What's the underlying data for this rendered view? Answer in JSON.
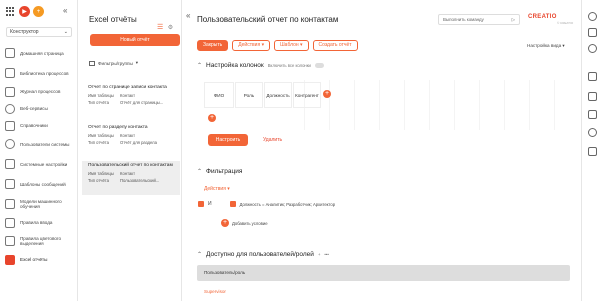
{
  "sidebar": {
    "workspace": "Конструктор",
    "items": [
      {
        "label": "Домашняя страница",
        "icon": "home-icon"
      },
      {
        "label": "Библиотека процессов",
        "icon": "process-library-icon"
      },
      {
        "label": "Журнал процессов",
        "icon": "process-log-icon"
      },
      {
        "label": "Веб-сервисы",
        "icon": "globe-icon"
      },
      {
        "label": "Справочники",
        "icon": "lookups-icon"
      },
      {
        "label": "Пользователи системы",
        "icon": "users-icon"
      },
      {
        "label": "Системные настройки",
        "icon": "system-settings-icon"
      },
      {
        "label": "Шаблоны сообщений",
        "icon": "message-templates-icon"
      },
      {
        "label": "Модели машинного обучения",
        "icon": "ml-models-icon"
      },
      {
        "label": "Правила ввода",
        "icon": "input-rules-icon"
      },
      {
        "label": "Правила цветового выделения",
        "icon": "color-rules-icon"
      },
      {
        "label": "Excel отчёты",
        "icon": "excel-reports-icon"
      }
    ]
  },
  "reports": {
    "title": "Excel отчёты",
    "new_button": "Новый отчёт",
    "filters": "Фильтры/группы",
    "cards": [
      {
        "title": "Отчет по странице записи контакта",
        "table_key": "Имя таблицы",
        "table_val": "Контакт",
        "type_key": "Тип отчёта",
        "type_val": "Отчёт для страницы..."
      },
      {
        "title": "Отчет по разделу контакта",
        "table_key": "Имя таблицы",
        "table_val": "Контакт",
        "type_key": "Тип отчёта",
        "type_val": "Отчёт для раздела"
      },
      {
        "title": "Пользовательский отчет по контактам",
        "table_key": "Имя таблицы",
        "table_val": "Контакт",
        "type_key": "Тип отчёта",
        "type_val": "Пользовательский..."
      }
    ]
  },
  "header": {
    "title": "Пользовательский отчет по контактам",
    "command_placeholder": "Выполнить команду",
    "brand": "CREATIO",
    "brand_sub": "© CREATIO"
  },
  "toolbar": {
    "close": "Закрыть",
    "actions": "Действия",
    "template": "Шаблон",
    "create_report": "Создать отчёт",
    "view_settings": "Настройка вида"
  },
  "columns_section": {
    "title": "Настройка колонок",
    "include_all": "Включить все колонки",
    "columns": [
      "ФИО",
      "Роль",
      "Должность",
      "Контрагент"
    ],
    "configure": "Настроить",
    "delete": "Удалить"
  },
  "filter_section": {
    "title": "Фильтрация",
    "actions": "Действия",
    "logic": "И",
    "condition": "Должность = Аналитик; Разработчик; Архитектор",
    "add_condition": "Добавить условие"
  },
  "permissions_section": {
    "title": "Доступно для пользователей/ролей",
    "column_header": "Пользователь/роль",
    "rows": [
      "Supervisor"
    ]
  },
  "colors": {
    "accent": "#f26537"
  }
}
